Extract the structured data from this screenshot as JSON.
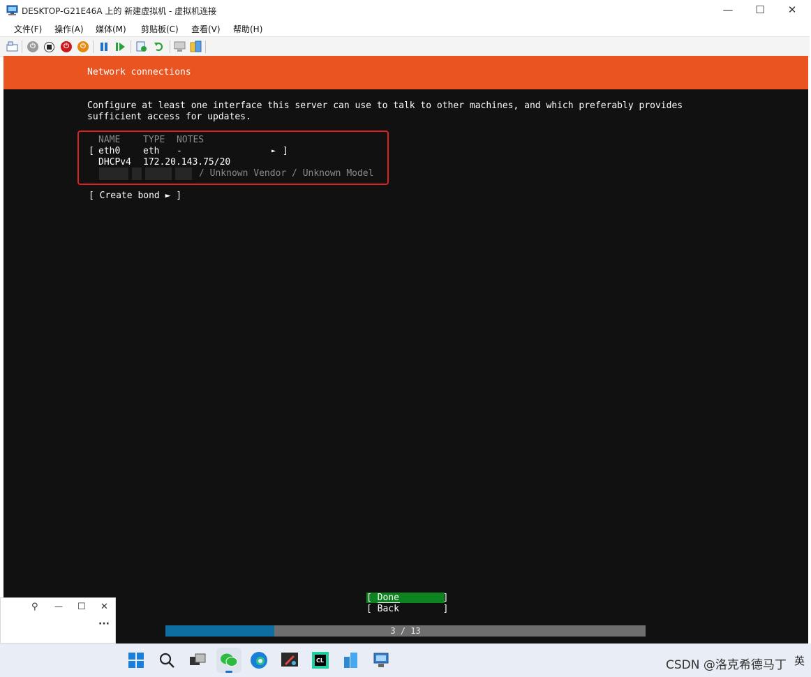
{
  "window": {
    "title": "DESKTOP-G21E46A 上的 新建虚拟机 - 虚拟机连接",
    "minimize_glyph": "—",
    "maximize_glyph": "☐",
    "close_glyph": "✕"
  },
  "menu": {
    "items": [
      "文件(F)",
      "操作(A)",
      "媒体(M)",
      "剪贴板(C)",
      "查看(V)",
      "帮助(H)"
    ]
  },
  "toolbar": {
    "icons": [
      "ctrl-alt-del-icon",
      "start-icon",
      "turn-off-icon",
      "shut-down-icon",
      "save-icon",
      "pause-icon",
      "reset-icon",
      "checkpoint-icon",
      "revert-icon",
      "enhanced-session-icon",
      "share-icon"
    ]
  },
  "installer": {
    "header_title": "Network connections",
    "description_line1": "Configure at least one interface this server can use to talk to other machines, and which preferably provides",
    "description_line2": "sufficient access for updates.",
    "table": {
      "header_name": "NAME",
      "header_type": "TYPE",
      "header_notes": "NOTES",
      "row_open_bracket": "[",
      "row_name": "eth0",
      "row_type": "eth",
      "row_notes": "-",
      "row_arrow": "►",
      "row_close_bracket": "]",
      "dhcp_label": "DHCPv4",
      "dhcp_address": "172.20.143.75/20",
      "vendor_model": "/ Unknown Vendor / Unknown Model"
    },
    "create_bond": "[ Create bond ► ]",
    "done_button": "[ Done        ]",
    "back_button": "[ Back        ]",
    "progress_text": "3 / 13",
    "progress_fraction": 0.2267
  },
  "miniwindow": {
    "pin_glyph": "⚲",
    "min_glyph": "—",
    "max_glyph": "☐",
    "close_glyph": "✕",
    "more_glyph": "···"
  },
  "taskbar": {
    "apps": [
      "windows-start-icon",
      "search-icon",
      "task-view-icon",
      "wechat-icon",
      "edge-icon",
      "snipping-tool-icon",
      "clion-icon",
      "app-icon",
      "hyper-v-manager-icon"
    ],
    "watermark": "CSDN @洛克希德马丁",
    "ime": "英"
  },
  "colors": {
    "ubuntu_orange": "#e95420",
    "console_bg": "#111111",
    "highlight_green": "#0e8420",
    "annotation_red": "#e02020",
    "progress_blue": "#0e6ea2"
  }
}
